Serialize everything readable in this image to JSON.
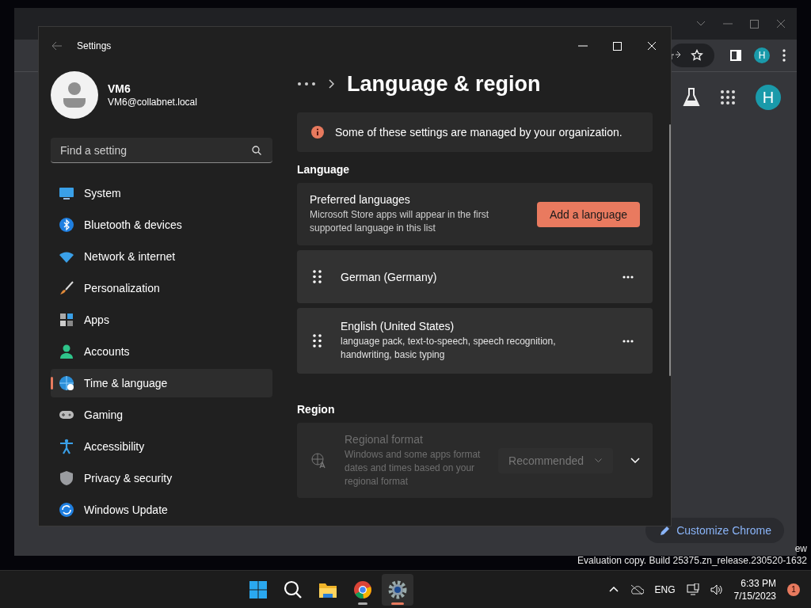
{
  "browser_window": {
    "profile_initial": "H",
    "account_initial": "H",
    "customize_button": "Customize Chrome"
  },
  "settings_window": {
    "title": "Settings",
    "user": {
      "name": "VM6",
      "email": "VM6@collabnet.local"
    },
    "search": {
      "placeholder": "Find a setting"
    },
    "nav": [
      {
        "label": "System",
        "selected": false
      },
      {
        "label": "Bluetooth & devices",
        "selected": false
      },
      {
        "label": "Network & internet",
        "selected": false
      },
      {
        "label": "Personalization",
        "selected": false
      },
      {
        "label": "Apps",
        "selected": false
      },
      {
        "label": "Accounts",
        "selected": false
      },
      {
        "label": "Time & language",
        "selected": true
      },
      {
        "label": "Gaming",
        "selected": false
      },
      {
        "label": "Accessibility",
        "selected": false
      },
      {
        "label": "Privacy & security",
        "selected": false
      },
      {
        "label": "Windows Update",
        "selected": false
      }
    ],
    "page_title": "Language & region",
    "notice": "Some of these settings are managed by your organization.",
    "language_section": {
      "heading": "Language",
      "preferred": {
        "title": "Preferred languages",
        "description": "Microsoft Store apps will appear in the first supported language in this list",
        "button": "Add a language"
      },
      "languages": [
        {
          "name": "German (Germany)"
        },
        {
          "name": "English (United States)",
          "features": "language pack, text-to-speech, speech recognition, handwriting, basic typing"
        }
      ]
    },
    "region_section": {
      "heading": "Region",
      "regional_format": {
        "title": "Regional format",
        "description": "Windows and some apps format dates and times based on your regional format",
        "value": "Recommended",
        "disabled": true
      }
    }
  },
  "desktop": {
    "watermark": [
      "ew",
      "Evaluation copy. Build 25375.zn_release.230520-1632"
    ]
  },
  "taskbar": {
    "apps": [
      {
        "selected": false
      },
      {
        "selected": false
      },
      {
        "selected": false
      },
      {
        "selected": false
      },
      {
        "selected": true
      }
    ],
    "language": "ENG",
    "time": "6:33 PM",
    "date": "7/15/2023",
    "notification_count": "1"
  }
}
